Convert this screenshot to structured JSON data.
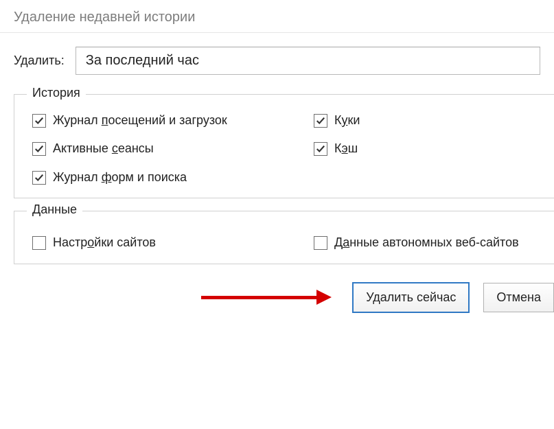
{
  "window": {
    "title": "Удаление недавней истории"
  },
  "time": {
    "label": "Удалить:",
    "selected": "За последний час",
    "options": [
      "За последний час"
    ]
  },
  "group_history": {
    "title": "История",
    "items": [
      {
        "label_pre": "Журнал ",
        "accel": "п",
        "label_post": "осещений и загрузок",
        "checked": true
      },
      {
        "label_pre": "К",
        "accel": "у",
        "label_post": "ки",
        "checked": true
      },
      {
        "label_pre": "Активные ",
        "accel": "с",
        "label_post": "еансы",
        "checked": true
      },
      {
        "label_pre": "К",
        "accel": "э",
        "label_post": "ш",
        "checked": true
      },
      {
        "label_pre": "Журнал ",
        "accel": "ф",
        "label_post": "орм и поиска",
        "checked": true
      }
    ]
  },
  "group_data": {
    "title": "Данные",
    "items": [
      {
        "label_pre": "Настр",
        "accel": "о",
        "label_post": "йки сайтов",
        "checked": false
      },
      {
        "label_pre": "Д",
        "accel": "а",
        "label_post": "нные автономных веб-сайтов",
        "checked": false
      }
    ]
  },
  "buttons": {
    "delete_now": "Удалить сейчас",
    "cancel": "Отмена"
  }
}
